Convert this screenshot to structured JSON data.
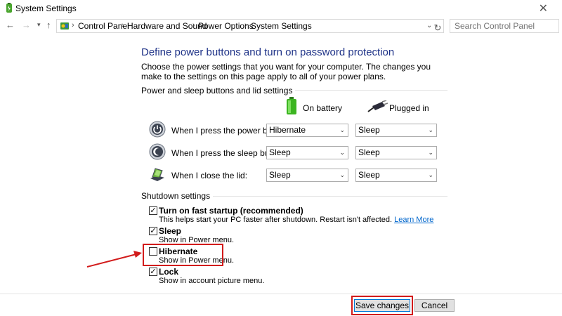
{
  "window": {
    "title": "System Settings",
    "close_glyph": "✕"
  },
  "nav": {
    "back_icon": "←",
    "forward_icon": "→",
    "recent_icon": "▾",
    "up_icon": "↑",
    "breadcrumbs": [
      "Control Panel",
      "Hardware and Sound",
      "Power Options",
      "System Settings"
    ],
    "separator": "›",
    "dropdown_icon": "⌄",
    "refresh_icon": "↻",
    "search_placeholder": "Search Control Panel",
    "search_icon": "⌕"
  },
  "main": {
    "heading": "Define power buttons and turn on password protection",
    "description": "Choose the power settings that you want for your computer. The changes you make to the settings on this page apply to all of your power plans.",
    "power_group_label": "Power and sleep buttons and lid settings",
    "col_battery": "On battery",
    "col_plugged": "Plugged in",
    "rows": [
      {
        "label": "When I press the power button:",
        "battery": "Hibernate",
        "plugged": "Sleep",
        "icon": "power-button-icon"
      },
      {
        "label": "When I press the sleep button:",
        "battery": "Sleep",
        "plugged": "Sleep",
        "icon": "sleep-button-icon"
      },
      {
        "label": "When I close the lid:",
        "battery": "Sleep",
        "plugged": "Sleep",
        "icon": "laptop-lid-icon"
      }
    ],
    "shutdown_group_label": "Shutdown settings",
    "shutdown": [
      {
        "label": "Turn on fast startup (recommended)",
        "desc": "This helps start your PC faster after shutdown. Restart isn't affected. ",
        "link": "Learn More",
        "checked": true
      },
      {
        "label": "Sleep",
        "desc": "Show in Power menu.",
        "checked": true
      },
      {
        "label": "Hibernate",
        "desc": "Show in Power menu.",
        "checked": false
      },
      {
        "label": "Lock",
        "desc": "Show in account picture menu.",
        "checked": true
      }
    ],
    "check_glyph": "✓"
  },
  "footer": {
    "save_label": "Save changes",
    "cancel_label": "Cancel"
  },
  "colors": {
    "heading": "#1e3287",
    "highlight": "#d21b1b",
    "link": "#0066cc"
  }
}
